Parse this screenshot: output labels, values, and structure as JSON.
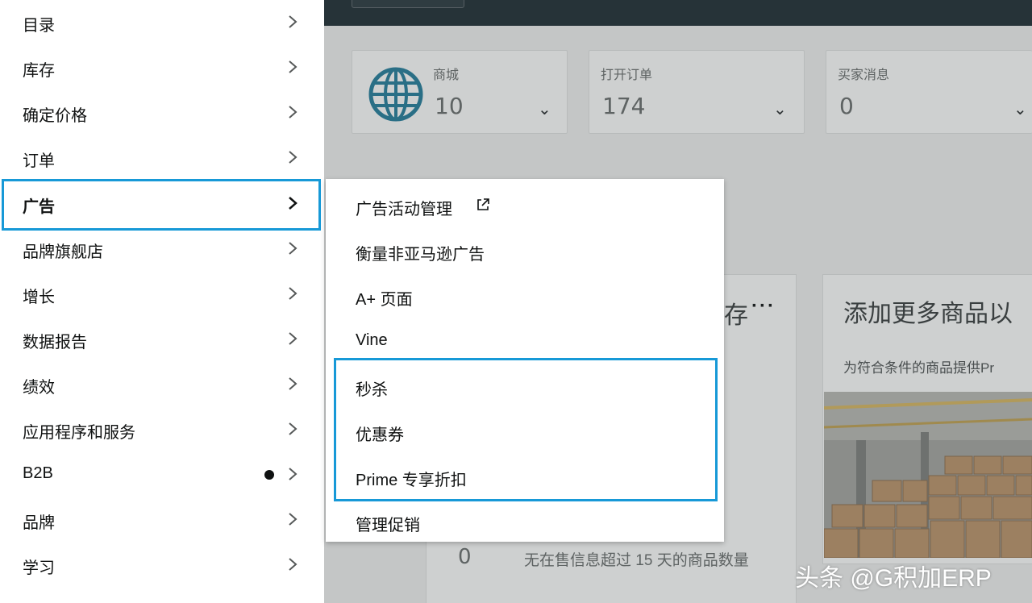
{
  "nav": {
    "items": [
      {
        "label": "目录"
      },
      {
        "label": "库存"
      },
      {
        "label": "确定价格"
      },
      {
        "label": "订单"
      },
      {
        "label": "广告"
      },
      {
        "label": "品牌旗舰店"
      },
      {
        "label": "增长"
      },
      {
        "label": "数据报告"
      },
      {
        "label": "绩效"
      },
      {
        "label": "应用程序和服务"
      },
      {
        "label": "B2B"
      },
      {
        "label": "品牌"
      },
      {
        "label": "学习"
      }
    ],
    "active_index": 4,
    "dot_item_index": 10
  },
  "flyout": {
    "items": [
      {
        "label": "广告活动管理",
        "external": true
      },
      {
        "label": "衡量非亚马逊广告"
      },
      {
        "label": "A+ 页面"
      },
      {
        "label": "Vine"
      },
      {
        "label": "秒杀"
      },
      {
        "label": "优惠券"
      },
      {
        "label": "Prime 专享折扣"
      },
      {
        "label": "管理促销"
      }
    ],
    "highlighted_range": [
      4,
      6
    ]
  },
  "dashboard": {
    "metrics": [
      {
        "label": "商城",
        "value": "10",
        "icon": "globe-icon"
      },
      {
        "label": "打开订单",
        "value": "174"
      },
      {
        "label": "买家消息",
        "value": "0"
      }
    ],
    "card_left_title_fragment": "存",
    "card_left_more": "···",
    "card_right_title": "添加更多商品以",
    "card_right_sub": "为符合条件的商品提供Pr",
    "bottom_count": "0",
    "bottom_label": "无在售信息超过 15 天的商品数量"
  },
  "watermark": "头条 @G积加ERP",
  "colors": {
    "highlight": "#1799d7",
    "menu_bg": "#ffffff",
    "overlay_bg": "#c4c6c6",
    "topbar": "#263338",
    "globe": "#2a6f86"
  }
}
